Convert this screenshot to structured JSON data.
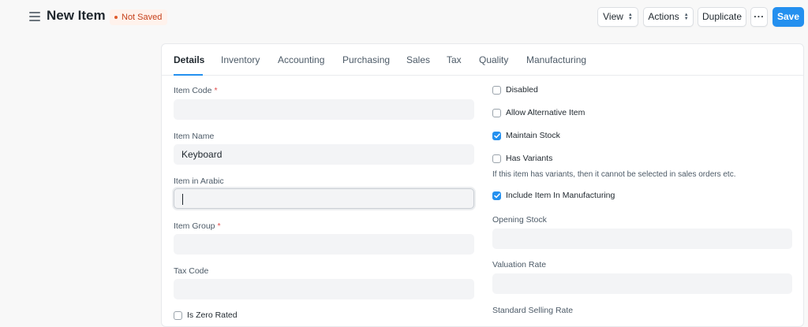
{
  "header": {
    "title": "New Item",
    "status": "Not Saved",
    "buttons": {
      "view": "View",
      "actions": "Actions",
      "duplicate": "Duplicate",
      "more": "···",
      "save": "Save"
    }
  },
  "tabs": [
    "Details",
    "Inventory",
    "Accounting",
    "Purchasing",
    "Sales",
    "Tax",
    "Quality",
    "Manufacturing"
  ],
  "left_fields": {
    "item_code": {
      "label": "Item Code",
      "required": "*",
      "value": ""
    },
    "item_name": {
      "label": "Item Name",
      "value": "Keyboard"
    },
    "item_in_arabic": {
      "label": "Item in Arabic",
      "value": ""
    },
    "item_group": {
      "label": "Item Group",
      "required": "*",
      "value": ""
    },
    "tax_code": {
      "label": "Tax Code",
      "value": ""
    },
    "is_zero_rated": {
      "label": "Is Zero Rated",
      "checked": false
    }
  },
  "right_checks": {
    "disabled": {
      "label": "Disabled",
      "checked": false
    },
    "allow_alternative_item": {
      "label": "Allow Alternative Item",
      "checked": false
    },
    "maintain_stock": {
      "label": "Maintain Stock",
      "checked": true
    },
    "has_variants": {
      "label": "Has Variants",
      "checked": false
    },
    "has_variants_help": "If this item has variants, then it cannot be selected in sales orders etc.",
    "include_in_manufacturing": {
      "label": "Include Item In Manufacturing",
      "checked": true
    }
  },
  "right_fields": {
    "opening_stock": {
      "label": "Opening Stock",
      "value": ""
    },
    "valuation_rate": {
      "label": "Valuation Rate",
      "value": ""
    },
    "standard_selling_rate": {
      "label": "Standard Selling Rate"
    }
  },
  "colors": {
    "primary": "#2490ef",
    "not_saved": "#c5401a",
    "required": "#e24c4c"
  }
}
